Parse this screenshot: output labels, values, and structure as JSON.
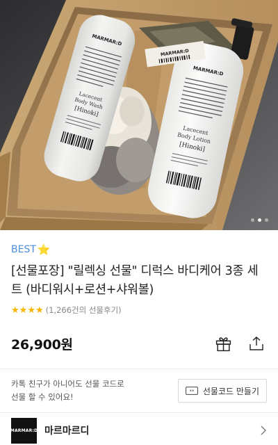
{
  "product": {
    "badge_label": "BEST",
    "badge_star": "⭐",
    "title": "[선물포장] \"릴렉싱 선물\" 디럭스 바디케어 3종 세트 (바디워시+로션+샤워볼)",
    "rating_stars": 4,
    "review_count_text": "(1,266건의 선물후기)",
    "price": "26,900원"
  },
  "hero_image": {
    "brand_text": "MARMAR:D",
    "bottle_left": {
      "line1": "Lacecent",
      "line2": "Body Wash",
      "line3": "[Hinoki]"
    },
    "bottle_right": {
      "line1": "Lacecent",
      "line2": "Body Lotion",
      "line3": "[Hinoki]"
    },
    "carousel": {
      "total": 3,
      "active": 2
    }
  },
  "gift": {
    "text_line1": "카톡 친구가 아니어도 선물 코드로",
    "text_line2": "선물 할 수 있어요!",
    "code_button_label": "선물코드 만들기"
  },
  "brand": {
    "logo_text": "MARMAR:D",
    "name": "마르마르디"
  },
  "colors": {
    "best_accent": "#4a90e2",
    "star": "#f7b500"
  },
  "icons": {
    "gift": "gift-icon",
    "share": "share-icon",
    "code": "code-icon",
    "chevron": "chevron-right-icon"
  }
}
